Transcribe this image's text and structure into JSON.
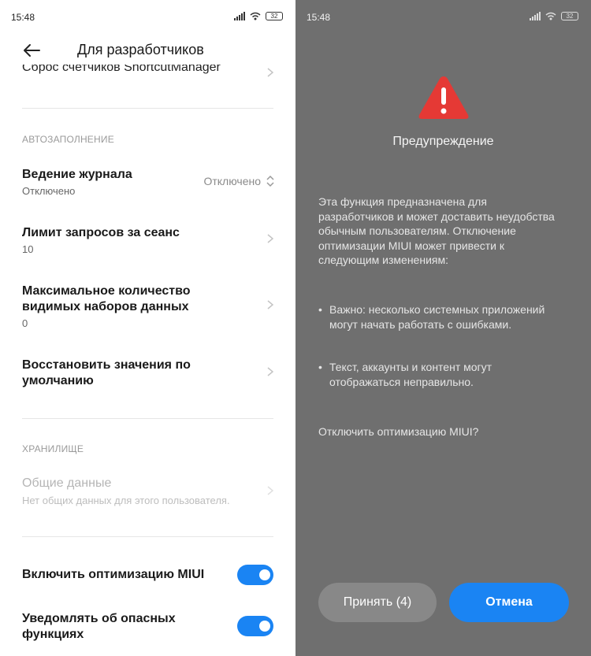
{
  "statusbar": {
    "time": "15:48",
    "battery": "32"
  },
  "settings": {
    "title": "Для разработчиков",
    "cut_item": "Сброс счетчиков ShortcutManager",
    "section_autofill": "АВТОЗАПОЛНЕНИЕ",
    "logging": {
      "title": "Ведение журнала",
      "sub": "Отключено",
      "value": "Отключено"
    },
    "request_limit": {
      "title": "Лимит запросов за сеанс",
      "sub": "10"
    },
    "max_datasets": {
      "title": "Максимальное количество видимых наборов данных",
      "sub": "0"
    },
    "reset_defaults": {
      "title": "Восстановить значения по умолчанию"
    },
    "section_storage": "ХРАНИЛИЩЕ",
    "shared_data": {
      "title": "Общие данные",
      "sub": "Нет общих данных для этого пользователя."
    },
    "miui_opt": {
      "title": "Включить оптимизацию MIUI",
      "enabled": true
    },
    "danger_notify": {
      "title": "Уведомлять об опасных функциях",
      "enabled": true
    }
  },
  "dialog": {
    "title": "Предупреждение",
    "body": "Эта функция предназначена для разработчиков и может доставить неудобства обычным пользователям. Отключение оптимизации MIUI может привести к следующим изменениям:",
    "bullet_1": "Важно: несколько системных приложений могут начать работать с ошибками.",
    "bullet_2": "Текст, аккаунты и контент могут отображаться неправильно.",
    "question": "Отключить оптимизацию MIUI?",
    "accept_label": "Принять (4)",
    "cancel_label": "Отмена"
  },
  "colors": {
    "accent": "#1a84f3",
    "warning": "#e53935",
    "overlay": "#6f6f6f"
  }
}
